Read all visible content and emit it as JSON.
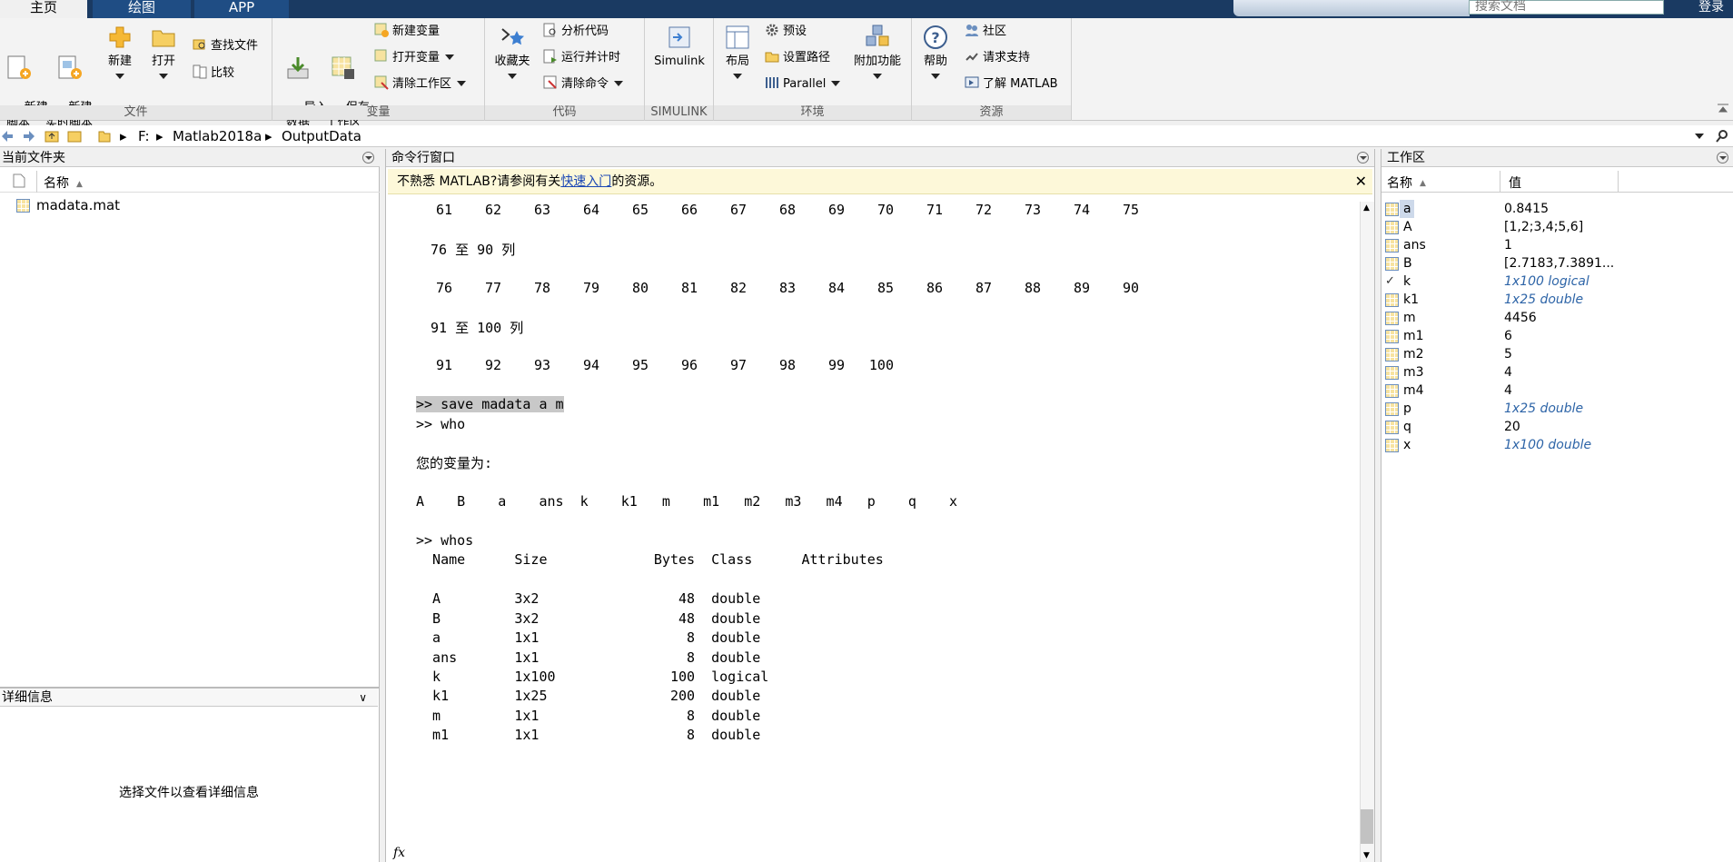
{
  "tabs": [
    "主页",
    "绘图",
    "APP"
  ],
  "search_placeholder": "搜索文档",
  "login": "登录",
  "ribbon": {
    "file": {
      "label": "文件",
      "new_script": "新建\n脚本",
      "new_live": "新建\n实时脚本",
      "new": "新建",
      "open": "打开",
      "find_files": "查找文件",
      "compare": "比较"
    },
    "variable": {
      "label": "变量",
      "import": "导入\n数据",
      "save_ws": "保存\n工作区",
      "new_var": "新建变量",
      "open_var": "打开变量",
      "clear_ws": "清除工作区"
    },
    "code": {
      "label": "代码",
      "favorites": "收藏夹",
      "analyze": "分析代码",
      "run_time": "运行并计时",
      "clear_cmds": "清除命令"
    },
    "simulink": {
      "label": "SIMULINK",
      "btn": "Simulink"
    },
    "env": {
      "label": "环境",
      "layout": "布局",
      "prefs": "预设",
      "set_path": "设置路径",
      "parallel": "Parallel",
      "addons": "附加功能"
    },
    "resources": {
      "label": "资源",
      "help": "帮助",
      "community": "社区",
      "support": "请求支持",
      "learn": "了解 MATLAB"
    }
  },
  "address": [
    "F:",
    "Matlab2018a",
    "OutputData"
  ],
  "current_folder": {
    "title": "当前文件夹",
    "col_name": "名称",
    "files": [
      "madata.mat"
    ]
  },
  "details": {
    "title": "详细信息",
    "empty": "选择文件以查看详细信息"
  },
  "command_window": {
    "title": "命令行窗口",
    "hint_pre": "不熟悉 MATLAB?请参阅有关",
    "hint_link": "快速入门",
    "hint_post": "的资源。",
    "row1": [
      "61",
      "62",
      "63",
      "64",
      "65",
      "66",
      "67",
      "68",
      "69",
      "70",
      "71",
      "72",
      "73",
      "74",
      "75"
    ],
    "hdr2": "76 至 90 列",
    "row2": [
      "76",
      "77",
      "78",
      "79",
      "80",
      "81",
      "82",
      "83",
      "84",
      "85",
      "86",
      "87",
      "88",
      "89",
      "90"
    ],
    "hdr3": "91 至 100 列",
    "row3": [
      "91",
      "92",
      "93",
      "94",
      "95",
      "96",
      "97",
      "98",
      "99",
      "100"
    ],
    "cmd_save": ">> save madata a m",
    "cmd_who": ">> who",
    "who_title": "您的变量为:",
    "who_list": "A    B    a    ans  k    k1   m    m1   m2   m3   m4   p    q    x",
    "cmd_whos": ">> whos",
    "whos_header": "  Name      Size             Bytes  Class      Attributes",
    "whos_rows": [
      "  A         3x2                 48  double",
      "  B         3x2                 48  double",
      "  a         1x1                  8  double",
      "  ans       1x1                  8  double",
      "  k         1x100              100  logical",
      "  k1        1x25               200  double",
      "  m         1x1                  8  double",
      "  m1        1x1                  8  double"
    ],
    "fx": "fx"
  },
  "workspace": {
    "title": "工作区",
    "col_name": "名称",
    "col_value": "值",
    "vars": [
      {
        "name": "a",
        "value": "0.8415",
        "italic": false
      },
      {
        "name": "A",
        "value": "[1,2;3,4;5,6]",
        "italic": false
      },
      {
        "name": "ans",
        "value": "1",
        "italic": false
      },
      {
        "name": "B",
        "value": "[2.7183,7.3891...",
        "italic": false
      },
      {
        "name": "k",
        "value": "1x100 logical",
        "italic": true
      },
      {
        "name": "k1",
        "value": "1x25 double",
        "italic": true
      },
      {
        "name": "m",
        "value": "4456",
        "italic": false
      },
      {
        "name": "m1",
        "value": "6",
        "italic": false
      },
      {
        "name": "m2",
        "value": "5",
        "italic": false
      },
      {
        "name": "m3",
        "value": "4",
        "italic": false
      },
      {
        "name": "m4",
        "value": "4",
        "italic": false
      },
      {
        "name": "p",
        "value": "1x25 double",
        "italic": true
      },
      {
        "name": "q",
        "value": "20",
        "italic": false
      },
      {
        "name": "x",
        "value": "1x100 double",
        "italic": true
      }
    ]
  }
}
